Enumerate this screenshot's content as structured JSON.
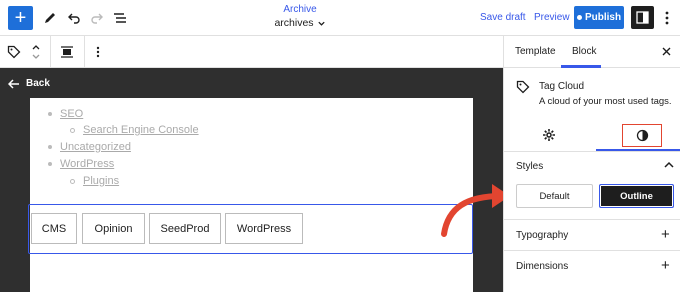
{
  "topbar": {
    "doc_type": "Archive",
    "doc_name": "archives",
    "save_draft": "Save draft",
    "preview": "Preview",
    "publish": "Publish"
  },
  "canvas": {
    "back_label": "Back",
    "categories": [
      {
        "label": "SEO",
        "level": 1
      },
      {
        "label": "Search Engine Console",
        "level": 2
      },
      {
        "label": "Uncategorized",
        "level": 1
      },
      {
        "label": "WordPress",
        "level": 1
      },
      {
        "label": "Plugins",
        "level": 2
      }
    ],
    "tags": [
      "CMS",
      "Opinion",
      "SeedProd",
      "WordPress"
    ]
  },
  "sidebar": {
    "tabs": [
      "Template",
      "Block"
    ],
    "active_tab": "Block",
    "block_title": "Tag Cloud",
    "block_desc": "A cloud of your most used tags.",
    "styles_label": "Styles",
    "style_options": [
      "Default",
      "Outline"
    ],
    "selected_style": "Outline",
    "panels": [
      "Typography",
      "Dimensions"
    ]
  },
  "colors": {
    "accent": "#3858e9",
    "publish_bg": "#1e6fd9",
    "highlight_red": "#e24530"
  },
  "icons": [
    "add-icon",
    "pen-icon",
    "undo-icon",
    "redo-icon",
    "list-view-icon",
    "chevron-down-icon",
    "settings-panel-icon",
    "more-vertical-icon",
    "tag-icon",
    "move-arrows-icon",
    "align-icon",
    "back-arrow-icon",
    "close-icon",
    "gear-icon",
    "contrast-icon",
    "chevron-up-icon",
    "plus-icon"
  ]
}
